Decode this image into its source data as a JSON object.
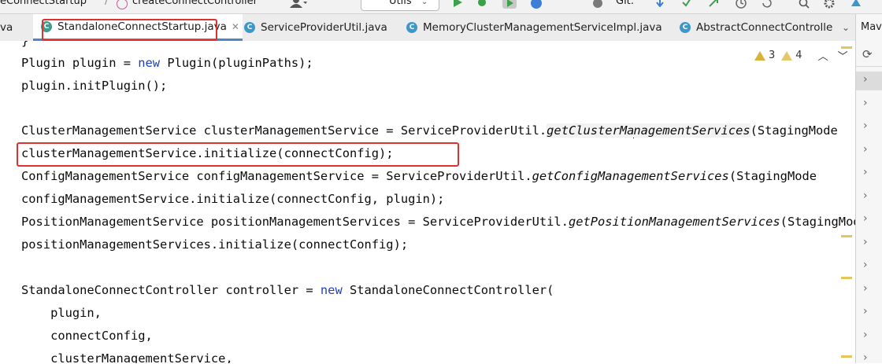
{
  "toolbar": {
    "crumb_file": "eConnectStartup",
    "crumb_method": "createConnectController",
    "run_config": "Utils",
    "git_label": "Git:"
  },
  "tabs": [
    {
      "label": "va"
    },
    {
      "label": "StandaloneConnectStartup.java",
      "icon": "c-class-icon",
      "active": true
    },
    {
      "label": "ServiceProviderUtil.java",
      "icon": "c-class-icon"
    },
    {
      "label": "MemoryClusterManagementServiceImpl.java",
      "icon": "c-class-icon"
    },
    {
      "label": "AbstractConnectControlle",
      "icon": "c-class-icon"
    }
  ],
  "side_panel": {
    "title": "Mav"
  },
  "inspections": {
    "warnings": "3",
    "weak_warnings": "4"
  },
  "code_lines": [
    {
      "segments": [
        {
          "t": "}",
          "c": ""
        }
      ]
    },
    {
      "segments": [
        {
          "t": "Plugin plugin = ",
          "c": ""
        },
        {
          "t": "new",
          "c": "kw"
        },
        {
          "t": " Plugin(pluginPaths);",
          "c": ""
        }
      ]
    },
    {
      "segments": [
        {
          "t": "plugin.initPlugin();",
          "c": ""
        }
      ]
    },
    {
      "segments": []
    },
    {
      "segments": [
        {
          "t": "ClusterManagementService clusterManagementService = ServiceProviderUtil.",
          "c": ""
        },
        {
          "t": "getClusterMa",
          "c": "it gl"
        },
        {
          "t": "CARET",
          "c": "caret"
        },
        {
          "t": "nagementServices",
          "c": "it gl"
        },
        {
          "t": "(StagingMode",
          "c": ""
        }
      ]
    },
    {
      "segments": [
        {
          "t": "clusterManagementService.initialize(connectConfig);",
          "c": ""
        }
      ]
    },
    {
      "segments": [
        {
          "t": "ConfigManagementService configManagementService = ServiceProviderUtil.",
          "c": ""
        },
        {
          "t": "getConfigManagementServices",
          "c": "it"
        },
        {
          "t": "(StagingMode",
          "c": ""
        }
      ]
    },
    {
      "segments": [
        {
          "t": "configManagementService.initialize(connectConfig, plugin);",
          "c": ""
        }
      ]
    },
    {
      "segments": [
        {
          "t": "PositionManagementService positionManagementServices = ServiceProviderUtil.",
          "c": ""
        },
        {
          "t": "getPositionManagementServices",
          "c": "it"
        },
        {
          "t": "(StagingMode",
          "c": ""
        }
      ]
    },
    {
      "segments": [
        {
          "t": "positionManagementServices.initialize(connectConfig);",
          "c": ""
        }
      ]
    },
    {
      "segments": []
    },
    {
      "segments": [
        {
          "t": "StandaloneConnectController controller = ",
          "c": ""
        },
        {
          "t": "new",
          "c": "kw"
        },
        {
          "t": " StandaloneConnectController(",
          "c": ""
        }
      ]
    },
    {
      "segments": [
        {
          "t": "    plugin,",
          "c": ""
        }
      ]
    },
    {
      "segments": [
        {
          "t": "    connectConfig,",
          "c": ""
        }
      ]
    },
    {
      "segments": [
        {
          "t": "    clusterManagementService,",
          "c": ""
        }
      ]
    }
  ]
}
